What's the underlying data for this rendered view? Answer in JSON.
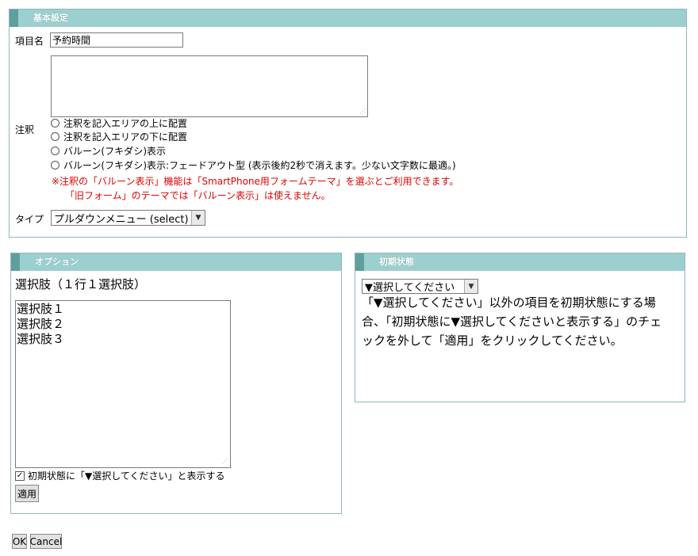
{
  "basic_settings": {
    "header": "基本設定",
    "item_name_label": "項目名",
    "item_name_value": "予約時間",
    "annotation_label": "注釈",
    "annotation_value": "",
    "radio_options": [
      "注釈を記入エリアの上に配置",
      "注釈を記入エリアの下に配置",
      "バルーン(フキダシ)表示",
      "バルーン(フキダシ)表示:フェードアウト型 (表示後約2秒で消えます。少ない文字数に最適。)"
    ],
    "note_line1": "※注釈の「バルーン表示」機能は「SmartPhone用フォームテーマ」を選ぶとご利用できます。",
    "note_line2": "「旧フォーム」のテーマでは「バルーン表示」は使えません。",
    "type_label": "タイプ",
    "type_value": "プルダウンメニュー (select)"
  },
  "options": {
    "header": "オプション",
    "choices_label": "選択肢（１行１選択肢）",
    "choices_value": "選択肢１\n選択肢２\n選択肢３",
    "initial_prompt_checkbox_label": "初期状態に「▼選択してください」と表示する",
    "initial_prompt_checked": true,
    "apply_label": "適用"
  },
  "initial_state": {
    "header": "初期状態",
    "select_value": "▼選択してください",
    "description": "「▼選択してください」以外の項目を初期状態にする場合、「初期状態に▼選択してくださいと表示する」のチェックを外して「適用」をクリックしてください。"
  },
  "footer": {
    "ok_label": "OK",
    "cancel_label": "Cancel"
  },
  "colors": {
    "header_bg": "#9ccfcf",
    "header_accent": "#5e9fa0",
    "panel_border": "#8fb8b8",
    "note_text": "#e00000"
  },
  "icons": {
    "select_arrow": "chevron-down-icon",
    "resize_grip": "resize-grip-icon",
    "checkbox_mark": "checkmark-icon"
  }
}
